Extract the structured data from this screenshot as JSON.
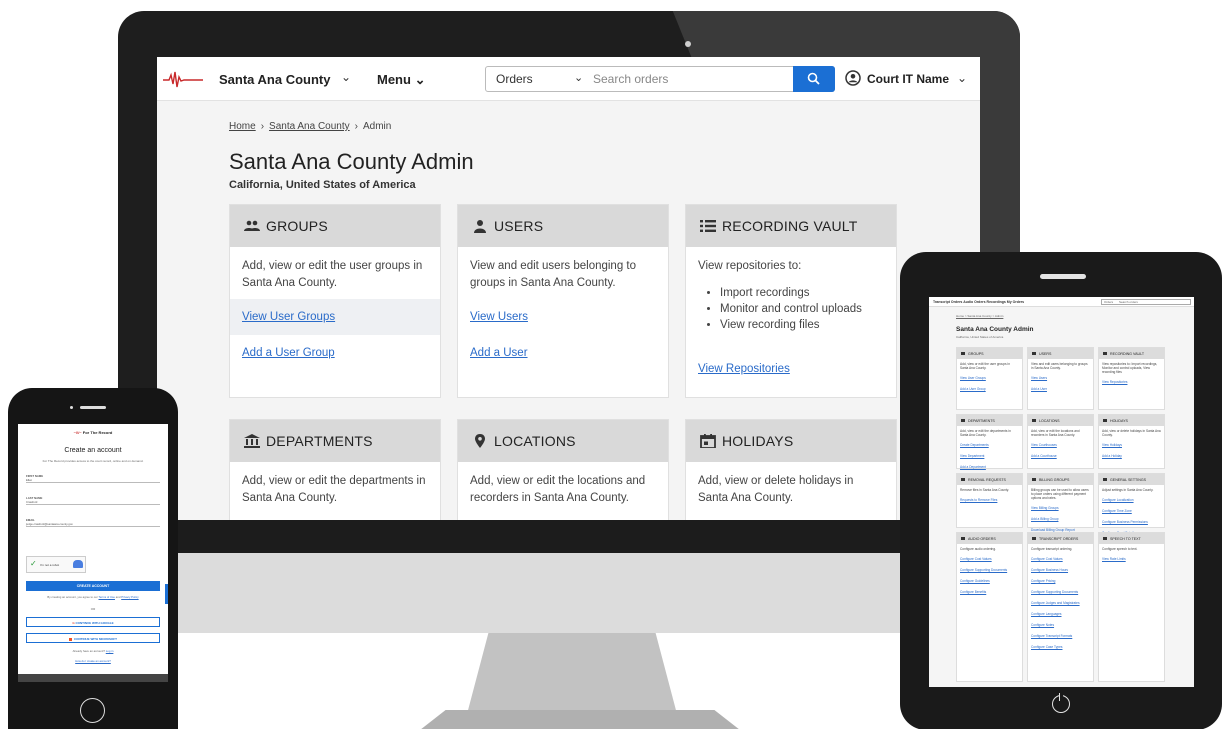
{
  "topbar": {
    "county": "Santa Ana County",
    "menu": "Menu",
    "search_category": "Orders",
    "search_placeholder": "Search orders",
    "user_name": "Court IT Name"
  },
  "breadcrumb": {
    "home": "Home",
    "county": "Santa Ana County",
    "current": "Admin"
  },
  "page": {
    "title": "Santa Ana County Admin",
    "subtitle": "California, United States of America"
  },
  "cards": {
    "groups": {
      "title": "GROUPS",
      "desc": "Add, view or edit the user groups in Santa Ana County.",
      "link1": "View User Groups",
      "link2": "Add a User Group"
    },
    "users": {
      "title": "USERS",
      "desc": "View and edit users belonging to groups in Santa Ana County.",
      "link1": "View Users",
      "link2": "Add a User"
    },
    "vault": {
      "title": "RECORDING VAULT",
      "desc": "View repositories to:",
      "items": [
        "Import recordings",
        "Monitor and control uploads",
        "View recording files"
      ],
      "link1": "View Repositories"
    },
    "departments": {
      "title": "DEPARTMENTS",
      "desc": "Add, view or edit the departments in Santa Ana County."
    },
    "locations": {
      "title": "LOCATIONS",
      "desc": "Add, view or edit the locations and recorders in Santa Ana County."
    },
    "holidays": {
      "title": "HOLIDAYS",
      "desc": "Add, view or delete holidays in Santa Ana County."
    }
  },
  "tablet": {
    "nav": "Transcript Orders   Audio Orders   Recordings   My Orders",
    "search_cat": "Orders",
    "search_ph": "Search orders",
    "crumb": "Home > Santa Ana County > Admin",
    "title": "Santa Ana County Admin",
    "subtitle": "California, United States of America",
    "cards": [
      {
        "title": "GROUPS",
        "desc": "Add, view or edit the user groups in Santa Ana County.",
        "links": [
          "View User Groups",
          "Add a User Group"
        ]
      },
      {
        "title": "USERS",
        "desc": "View and edit users belonging to groups in Santa Ana County.",
        "links": [
          "View Users",
          "Add a User"
        ]
      },
      {
        "title": "RECORDING VAULT",
        "desc": "View repositories to: Import recordings, Monitor and control uploads, View recording files",
        "links": [
          "View Repositories"
        ]
      },
      {
        "title": "DEPARTMENTS",
        "desc": "Add, view or edit the departments in Santa Ana County.",
        "links": [
          "Create Departments",
          "View Department",
          "Add a Department"
        ]
      },
      {
        "title": "LOCATIONS",
        "desc": "Add, view or edit the locations and recorders in Santa Ana County.",
        "links": [
          "View Courthouses",
          "Add a Courthouse"
        ]
      },
      {
        "title": "HOLIDAYS",
        "desc": "Add, view or delete holidays in Santa Ana County.",
        "links": [
          "View Holidays",
          "Add a Holiday"
        ]
      },
      {
        "title": "REMOVAL REQUESTS",
        "desc": "Remove files in Santa Ana County.",
        "links": [
          "Requests to Remove Files"
        ]
      },
      {
        "title": "BILLING GROUPS",
        "desc": "Billing groups can be used to allow users to place orders using different payment options and rates.",
        "links": [
          "View Billing Groups",
          "Add a Billing Group",
          "Download Billing Group Report"
        ]
      },
      {
        "title": "GENERAL SETTINGS",
        "desc": "Adjust settings in Santa Ana County.",
        "links": [
          "Configure Localization",
          "Configure Time Zone",
          "Configure Business Permissions",
          "Configure Court Details"
        ]
      },
      {
        "title": "AUDIO ORDERS",
        "desc": "Configure audio ordering.",
        "links": [
          "Configure Cost Values",
          "Configure Supporting Documents",
          "Configure Guidelines",
          "Configure Benefits"
        ]
      },
      {
        "title": "TRANSCRIPT ORDERS",
        "desc": "Configure transcript ordering.",
        "links": [
          "Configure Cost Values",
          "Configure Business Hours",
          "Configure Pricing",
          "Configure Supporting Documents",
          "Configure Judges and Magistrates",
          "Configure Languages",
          "Configure Notes",
          "Configure Transcript Formats",
          "Configure Case Types"
        ]
      },
      {
        "title": "SPEECH TO TEXT",
        "desc": "Configure speech to text.",
        "links": [
          "View Rate Limits"
        ]
      }
    ]
  },
  "phone": {
    "brand": "For The Record",
    "title": "Create an account",
    "desc": "For The Record provides access to the court record, online and on demand.",
    "first_name_label": "FIRST NAME",
    "first_name": "Ellen",
    "last_name_label": "LAST NAME",
    "last_name": "Crawford",
    "email_label": "EMAIL",
    "email": "judge.crawford@santaana.county.gov",
    "captcha": "I'm not a robot",
    "create": "CREATE ACCOUNT",
    "agree_pre": "By creating an account, you agree to our",
    "terms": "Terms of Use",
    "and": "and",
    "privacy": "Privacy Policy",
    "or": "OR",
    "google": "CONTINUE WITH GOOGLE",
    "microsoft": "CONTINUE WITH MICROSOFT",
    "have_account": "Already have an account?",
    "login": "Log in",
    "create_q": "How do I create an account?"
  }
}
